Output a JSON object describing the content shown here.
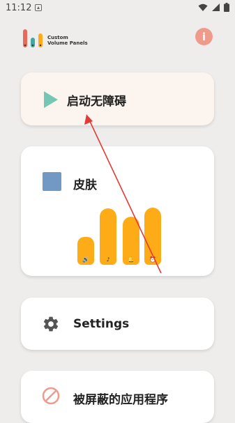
{
  "status_bar": {
    "time": "11:12"
  },
  "logo": {
    "line1": "Custom",
    "line2": "Volume Panels"
  },
  "info_button": {
    "label": "i"
  },
  "cards": {
    "start": {
      "label": "启动无障碍"
    },
    "skin": {
      "label": "皮肤"
    },
    "settings": {
      "label": "Settings"
    },
    "blocked": {
      "label": "被屏蔽的应用程序"
    }
  },
  "volume_sliders": [
    {
      "icon": "speaker-icon",
      "glyph": "🔊",
      "level": 0.47
    },
    {
      "icon": "music-note-icon",
      "glyph": "♪",
      "level": 0.95
    },
    {
      "icon": "ringer-bell-icon",
      "glyph": "🔔",
      "level": 0.81
    },
    {
      "icon": "alarm-clock-icon",
      "glyph": "⏰",
      "level": 0.97
    }
  ],
  "colors": {
    "background": "#eeedec",
    "card": "#ffffff",
    "start_card": "#fcf5ef",
    "play_accent": "#76c6b6",
    "skin_swatch": "#7299c3",
    "volume_bar": "#fdac17",
    "info_button": "#ee9b8c",
    "annotation_arrow": "#e53935"
  }
}
